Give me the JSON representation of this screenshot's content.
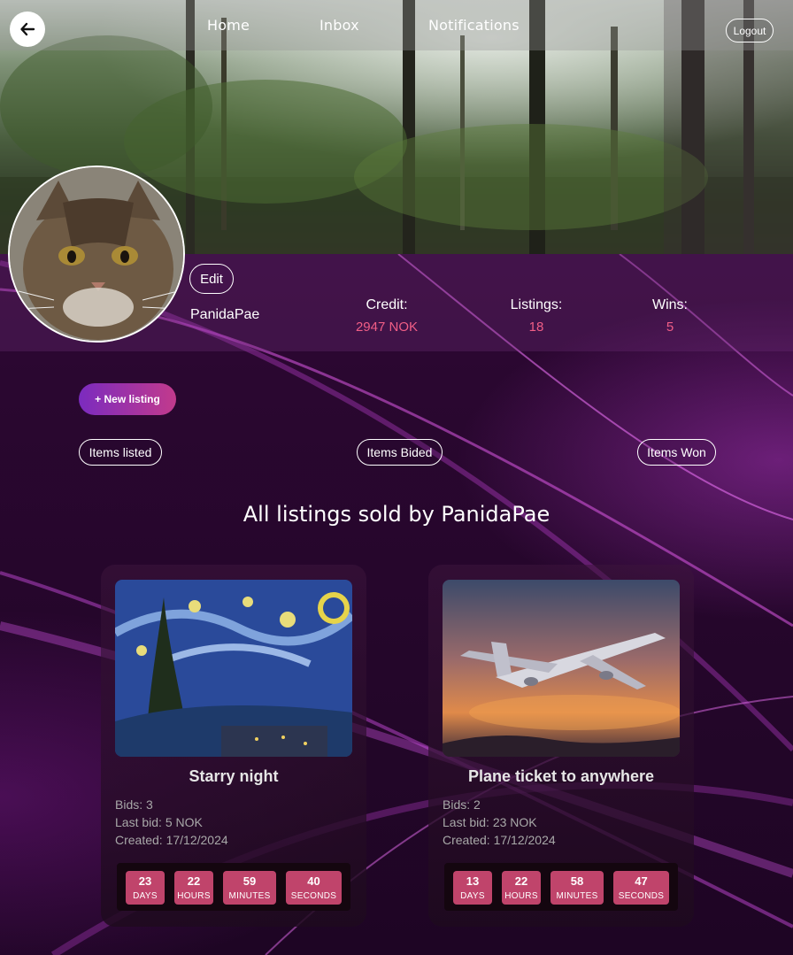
{
  "nav": {
    "links": [
      "Home",
      "Inbox",
      "Notifications"
    ],
    "logout_label": "Logout"
  },
  "profile": {
    "edit_label": "Edit",
    "username": "PanidaPae",
    "stats": [
      {
        "label": "Credit:",
        "value": "2947 NOK"
      },
      {
        "label": "Listings:",
        "value": "18"
      },
      {
        "label": "Wins:",
        "value": "5"
      }
    ]
  },
  "actions": {
    "new_listing_label": "+ New listing",
    "filters": [
      "Items listed",
      "Items Bided",
      "Items Won"
    ]
  },
  "section_title": "All listings sold by PanidaPae",
  "listings": [
    {
      "title": "Starry night",
      "bids": "Bids: 3",
      "last_bid": "Last bid: 5 NOK",
      "created": "Created: 17/12/2024",
      "countdown": [
        {
          "value": "23",
          "unit": "DAYS"
        },
        {
          "value": "22",
          "unit": "HOURS"
        },
        {
          "value": "59",
          "unit": "MINUTES"
        },
        {
          "value": "40",
          "unit": "SECONDS"
        }
      ]
    },
    {
      "title": "Plane ticket to anywhere",
      "bids": "Bids: 2",
      "last_bid": "Last bid: 23 NOK",
      "created": "Created: 17/12/2024",
      "countdown": [
        {
          "value": "13",
          "unit": "DAYS"
        },
        {
          "value": "22",
          "unit": "HOURS"
        },
        {
          "value": "58",
          "unit": "MINUTES"
        },
        {
          "value": "47",
          "unit": "SECONDS"
        }
      ]
    }
  ],
  "colors": {
    "accent": "#f05e86",
    "countdown_box": "#c0446b",
    "button_gradient_start": "#7b2bbf",
    "button_gradient_end": "#c23a8c"
  }
}
